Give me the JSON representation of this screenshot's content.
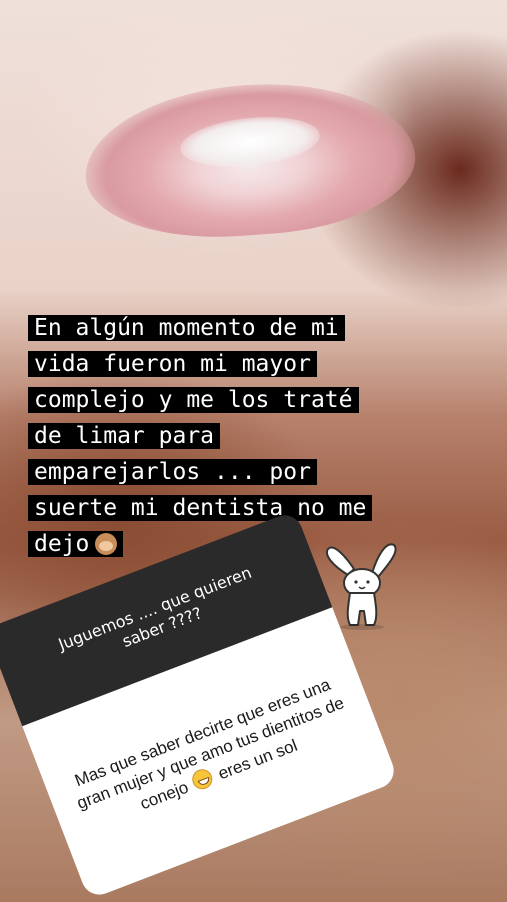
{
  "caption": {
    "lines": [
      "En algún momento de mi",
      "vida fueron mi mayor",
      "complejo y me los traté",
      "de limar para",
      "emparejarlos ... por",
      "suerte mi dentista no me",
      "dejo"
    ],
    "emoji": "see-no-evil-monkey"
  },
  "question_card": {
    "prompt": "Juguemos .... que quieren saber ????",
    "answer_before_emoji": "Mas que saber decirte que eres una gran mujer y que amo tus dientitos de conejo",
    "emoji": "grinning-face",
    "answer_after_emoji": "eres un sol"
  },
  "sticker": "bunny"
}
